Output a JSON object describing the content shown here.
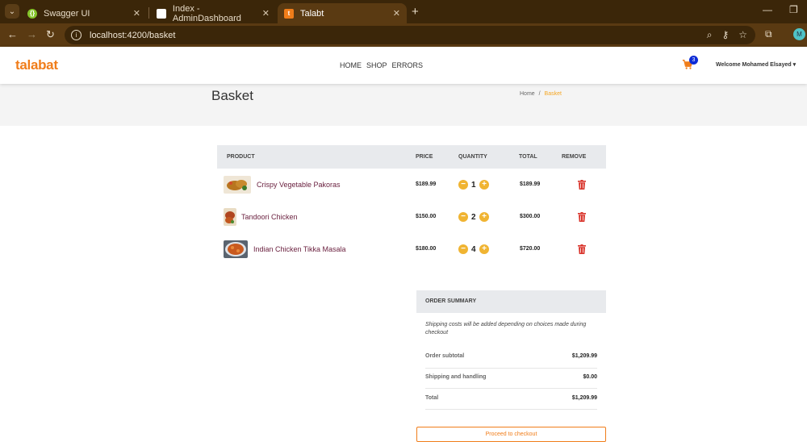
{
  "browser": {
    "tabs": [
      {
        "title": "Swagger UI",
        "favicon_color": "#85c52b"
      },
      {
        "title": "Index - AdminDashboard",
        "favicon_color": "#ffffff"
      },
      {
        "title": "Talabt",
        "favicon_color": "#f07d1a",
        "favicon_letter": "t"
      }
    ],
    "url": "localhost:4200/basket",
    "profile_initial": "M"
  },
  "header": {
    "logo": "talabat",
    "nav": [
      "HOME",
      "SHOP",
      "ERRORS"
    ],
    "cart_count": "3",
    "welcome": "Welcome Mohamed Elsayed"
  },
  "page": {
    "title": "Basket",
    "breadcrumb": {
      "home": "Home",
      "sep": "/",
      "current": "Basket"
    }
  },
  "table": {
    "headers": {
      "product": "PRODUCT",
      "price": "PRICE",
      "quantity": "QUANTITY",
      "total": "TOTAL",
      "remove": "REMOVE"
    },
    "rows": [
      {
        "name": "Crispy Vegetable Pakoras",
        "price": "$189.99",
        "qty": "1",
        "total": "$189.99"
      },
      {
        "name": "Tandoori Chicken",
        "price": "$150.00",
        "qty": "2",
        "total": "$300.00"
      },
      {
        "name": "Indian Chicken Tikka Masala",
        "price": "$180.00",
        "qty": "4",
        "total": "$720.00"
      }
    ]
  },
  "summary": {
    "title": "ORDER SUMMARY",
    "note": "Shipping costs will be added depending on choices made during checkout",
    "subtotal_label": "Order subtotal",
    "subtotal": "$1,209.99",
    "shipping_label": "Shipping and handling",
    "shipping": "$0.00",
    "total_label": "Total",
    "total": "$1,209.99",
    "checkout_label": "Proceed to checkout"
  },
  "colors": {
    "brand": "#f07d1a",
    "accent": "#f0b432",
    "danger": "#d9342b",
    "badge": "#0d2bd6"
  }
}
